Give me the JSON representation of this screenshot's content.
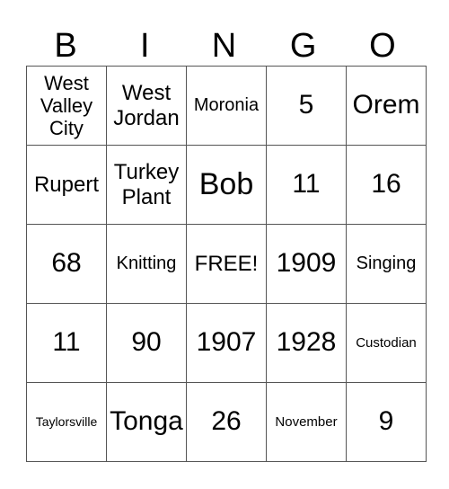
{
  "header": [
    "B",
    "I",
    "N",
    "G",
    "O"
  ],
  "rows": [
    [
      "West Valley City",
      "West Jordan",
      "Moronia",
      "5",
      "Orem"
    ],
    [
      "Rupert",
      "Turkey Plant",
      "Bob",
      "11",
      "16"
    ],
    [
      "68",
      "Knitting",
      "FREE!",
      "1909",
      "Singing"
    ],
    [
      "11",
      "90",
      "1907",
      "1928",
      "Custodian"
    ],
    [
      "Taylorsville",
      "Tonga",
      "26",
      "November",
      "9"
    ]
  ]
}
